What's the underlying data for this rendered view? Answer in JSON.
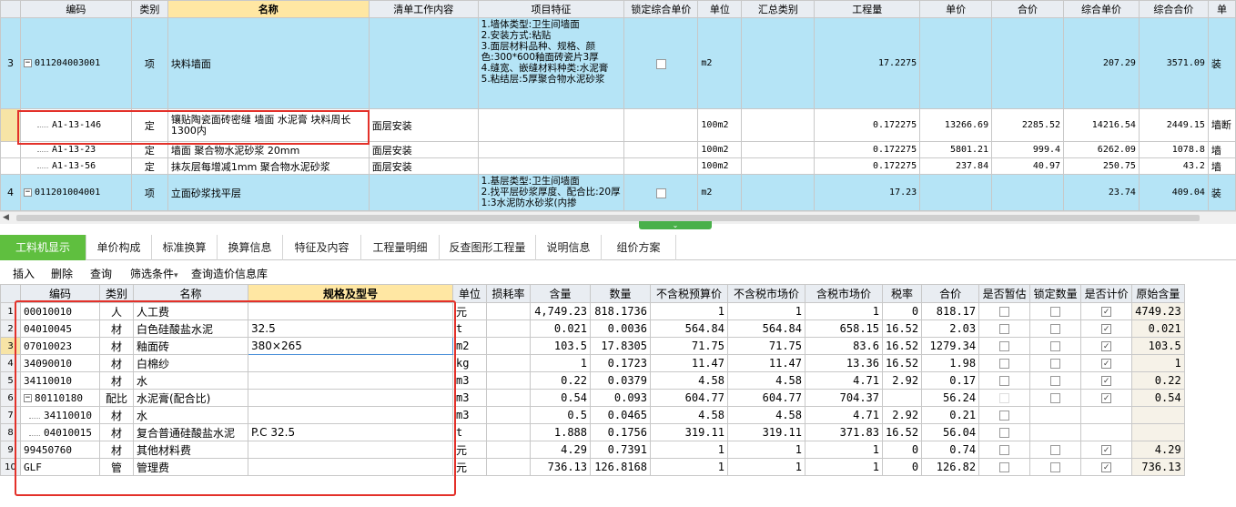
{
  "top_table": {
    "columns": [
      "",
      "编码",
      "类别",
      "名称",
      "清单工作内容",
      "项目特征",
      "锁定综合单价",
      "单位",
      "汇总类别",
      "工程量",
      "单价",
      "合价",
      "综合单价",
      "综合合价",
      "单"
    ],
    "rows": [
      {
        "kind": "bq",
        "rownum": "3",
        "toggle": "−",
        "code": "011204003001",
        "type": "项",
        "name": "块料墙面",
        "work": "",
        "feature": "1.墙体类型:卫生间墙面\n2.安装方式:粘贴\n3.面层材料品种、规格、颜色:300*600釉面砖瓷片3厚\n4.缝宽、嵌缝材料种类:水泥膏\n5.粘结层:5厚聚合物水泥砂浆",
        "locked": false,
        "unit": "m2",
        "sum_type": "",
        "qty": "17.2275",
        "price": "",
        "total": "",
        "comp_price": "207.29",
        "comp_total": "3571.09",
        "extra": "装"
      },
      {
        "kind": "de",
        "selected": true,
        "rownum": "",
        "code": "A1-13-146",
        "type": "定",
        "name": "镶贴陶瓷面砖密缝 墙面 水泥膏 块料周长1300内",
        "work": "面层安装",
        "feature": "",
        "unit": "100m2",
        "sum_type": "",
        "qty": "0.172275",
        "price": "13266.69",
        "total": "2285.52",
        "comp_price": "14216.54",
        "comp_total": "2449.15",
        "extra": "墙断"
      },
      {
        "kind": "de",
        "rownum": "",
        "code": "A1-13-23",
        "type": "定",
        "name": "墙面 聚合物水泥砂浆 20mm",
        "work": "面层安装",
        "feature": "",
        "unit": "100m2",
        "sum_type": "",
        "qty": "0.172275",
        "price": "5801.21",
        "total": "999.4",
        "comp_price": "6262.09",
        "comp_total": "1078.8",
        "extra": "墙"
      },
      {
        "kind": "de",
        "rownum": "",
        "code": "A1-13-56",
        "type": "定",
        "name": "抹灰层每增减1mm 聚合物水泥砂浆",
        "work": "面层安装",
        "feature": "",
        "unit": "100m2",
        "sum_type": "",
        "qty": "0.172275",
        "price": "237.84",
        "total": "40.97",
        "comp_price": "250.75",
        "comp_total": "43.2",
        "extra": "墙"
      },
      {
        "kind": "bq",
        "rownum": "4",
        "toggle": "−",
        "code": "011201004001",
        "type": "项",
        "name": "立面砂浆找平层",
        "work": "",
        "feature": "1.基层类型:卫生间墙面\n2.找平层砂浆厚度、配合比:20厚1:3水泥防水砂浆(内掺",
        "locked": false,
        "unit": "m2",
        "sum_type": "",
        "qty": "17.23",
        "price": "",
        "total": "",
        "comp_price": "23.74",
        "comp_total": "409.04",
        "extra": "装"
      }
    ]
  },
  "splitter_icon": "double-chevron-down-icon",
  "tabs": [
    {
      "label": "工料机显示",
      "active": true
    },
    {
      "label": "单价构成"
    },
    {
      "label": "标准换算"
    },
    {
      "label": "换算信息"
    },
    {
      "label": "特征及内容"
    },
    {
      "label": "工程量明细"
    },
    {
      "label": "反查图形工程量"
    },
    {
      "label": "说明信息"
    },
    {
      "label": "组价方案"
    }
  ],
  "toolbar": {
    "insert": "插入",
    "delete": "删除",
    "query": "查询",
    "filter": "筛选条件",
    "filter_arrow": "▾",
    "query_price_db": "查询造价信息库"
  },
  "bottom_table": {
    "columns": [
      "",
      "编码",
      "类别",
      "名称",
      "规格及型号",
      "单位",
      "损耗率",
      "含量",
      "数量",
      "不含税预算价",
      "不含税市场价",
      "含税市场价",
      "税率",
      "合价",
      "是否暂估",
      "锁定数量",
      "是否计价",
      "原始含量"
    ],
    "rows": [
      {
        "rownum": "1",
        "code": "00010010",
        "type": "人",
        "name": "人工费",
        "spec": "",
        "unit": "元",
        "loss": "",
        "content": "4,749.23",
        "qty": "818.1736",
        "budget": "1",
        "market": "1",
        "market_tax": "1",
        "tax": "0",
        "total": "818.17",
        "provisional": false,
        "lock_qty": false,
        "priced": true,
        "orig": "4749.23"
      },
      {
        "rownum": "2",
        "code": "04010045",
        "type": "材",
        "name": "白色硅酸盐水泥",
        "spec": "32.5",
        "unit": "t",
        "loss": "",
        "content": "0.021",
        "qty": "0.0036",
        "budget": "564.84",
        "market": "564.84",
        "market_tax": "658.15",
        "tax": "16.52",
        "total": "2.03",
        "provisional": false,
        "lock_qty": false,
        "priced": true,
        "orig": "0.021"
      },
      {
        "rownum": "3",
        "current": true,
        "code": "07010023",
        "type": "材",
        "name": "釉面砖",
        "spec": "380×265",
        "unit": "m2",
        "loss": "",
        "content": "103.5",
        "qty": "17.8305",
        "budget": "71.75",
        "market": "71.75",
        "market_tax": "83.6",
        "tax": "16.52",
        "total": "1279.34",
        "provisional": false,
        "lock_qty": false,
        "priced": true,
        "orig": "103.5"
      },
      {
        "rownum": "4",
        "code": "34090010",
        "type": "材",
        "name": "白棉纱",
        "spec": "",
        "unit": "kg",
        "loss": "",
        "content": "1",
        "qty": "0.1723",
        "budget": "11.47",
        "market": "11.47",
        "market_tax": "13.36",
        "tax": "16.52",
        "total": "1.98",
        "provisional": false,
        "lock_qty": false,
        "priced": true,
        "orig": "1"
      },
      {
        "rownum": "5",
        "code": "34110010",
        "type": "材",
        "name": "水",
        "spec": "",
        "unit": "m3",
        "loss": "",
        "content": "0.22",
        "qty": "0.0379",
        "budget": "4.58",
        "market": "4.58",
        "market_tax": "4.71",
        "tax": "2.92",
        "total": "0.17",
        "provisional": false,
        "lock_qty": false,
        "priced": true,
        "orig": "0.22"
      },
      {
        "rownum": "6",
        "toggle": "−",
        "code": "80110180",
        "type": "配比",
        "name": "水泥膏(配合比)",
        "spec": "",
        "unit": "m3",
        "loss": "",
        "content": "0.54",
        "qty": "0.093",
        "budget": "604.77",
        "market": "604.77",
        "market_tax": "704.37",
        "tax": "",
        "total": "56.24",
        "provisional": "disabled",
        "lock_qty": false,
        "priced": true,
        "orig": "0.54"
      },
      {
        "rownum": "7",
        "child": true,
        "code": "34110010",
        "type": "材",
        "name": "水",
        "spec": "",
        "unit": "m3",
        "loss": "",
        "content": "0.5",
        "qty": "0.0465",
        "budget": "4.58",
        "market": "4.58",
        "market_tax": "4.71",
        "tax": "2.92",
        "total": "0.21",
        "provisional": false,
        "lock_qty": null,
        "priced": null,
        "orig": ""
      },
      {
        "rownum": "8",
        "child": true,
        "code": "04010015",
        "type": "材",
        "name": "复合普通硅酸盐水泥",
        "spec": "P.C 32.5",
        "unit": "t",
        "loss": "",
        "content": "1.888",
        "qty": "0.1756",
        "budget": "319.11",
        "market": "319.11",
        "market_tax": "371.83",
        "tax": "16.52",
        "total": "56.04",
        "provisional": false,
        "lock_qty": null,
        "priced": null,
        "orig": ""
      },
      {
        "rownum": "9",
        "code": "99450760",
        "type": "材",
        "name": "其他材料费",
        "spec": "",
        "unit": "元",
        "loss": "",
        "content": "4.29",
        "qty": "0.7391",
        "budget": "1",
        "market": "1",
        "market_tax": "1",
        "tax": "0",
        "total": "0.74",
        "provisional": false,
        "lock_qty": false,
        "priced": true,
        "orig": "4.29"
      },
      {
        "rownum": "10",
        "code": "GLF",
        "type": "管",
        "name": "管理费",
        "spec": "",
        "unit": "元",
        "loss": "",
        "content": "736.13",
        "qty": "126.8168",
        "budget": "1",
        "market": "1",
        "market_tax": "1",
        "tax": "0",
        "total": "126.82",
        "provisional": false,
        "lock_qty": false,
        "priced": true,
        "orig": "736.13"
      }
    ]
  },
  "colors": {
    "header_bg": "#e9edf2",
    "bq_row": "#b5e4f6",
    "active_tab": "#5fbf3f",
    "highlight_header": "#ffe7a3",
    "annotation_red": "#e3312a"
  }
}
